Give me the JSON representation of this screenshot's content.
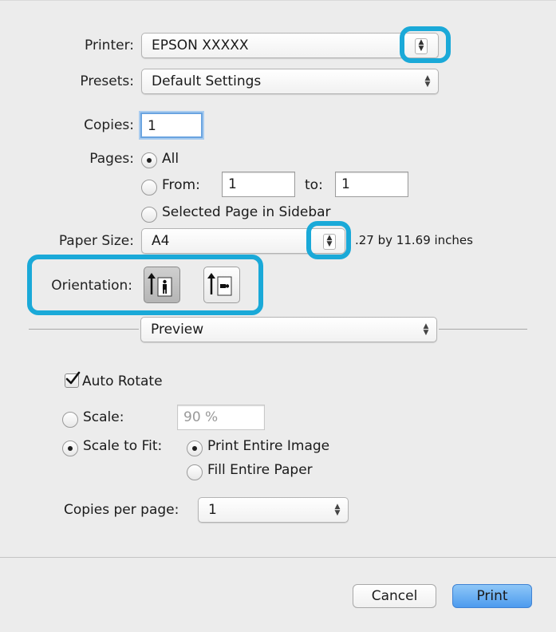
{
  "printer": {
    "label": "Printer:",
    "value": "EPSON XXXXX"
  },
  "presets": {
    "label": "Presets:",
    "value": "Default Settings"
  },
  "copies": {
    "label": "Copies:",
    "value": "1"
  },
  "pages": {
    "label": "Pages:",
    "all_label": "All",
    "from_label": "From:",
    "from_value": "1",
    "to_label": "to:",
    "to_value": "1",
    "selected_label": "Selected Page in Sidebar"
  },
  "paper_size": {
    "label": "Paper Size:",
    "value": "A4",
    "dimensions": ".27 by 11.69 inches"
  },
  "orientation": {
    "label": "Orientation:",
    "selected": "portrait"
  },
  "section": {
    "value": "Preview"
  },
  "preview": {
    "auto_rotate_label": "Auto Rotate",
    "auto_rotate_checked": true,
    "scale_label": "Scale:",
    "scale_value": "90 %",
    "scale_to_fit_label": "Scale to Fit:",
    "print_entire_image_label": "Print Entire Image",
    "fill_entire_paper_label": "Fill Entire Paper",
    "copies_per_page_label": "Copies per page:",
    "copies_per_page_value": "1"
  },
  "buttons": {
    "cancel": "Cancel",
    "print": "Print"
  },
  "colors": {
    "highlight": "#1aa9d8",
    "default_button": "#4d9bee",
    "background": "#ececec"
  }
}
